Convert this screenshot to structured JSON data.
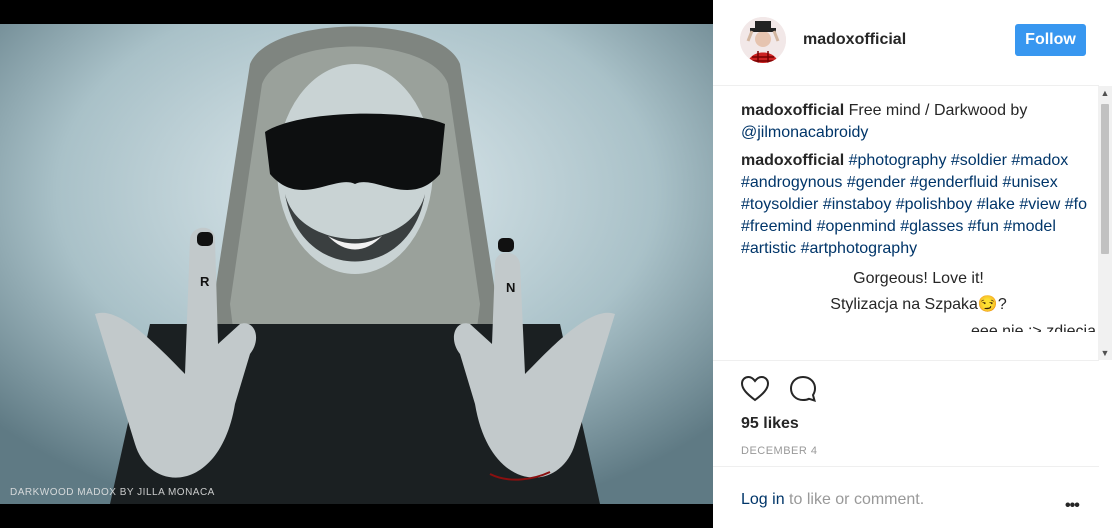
{
  "photo": {
    "watermark": "DARKWOOD MADOX BY JILLA MONACA",
    "finger_letters": [
      "R",
      "N"
    ]
  },
  "header": {
    "username": "madoxofficial",
    "follow_label": "Follow"
  },
  "comments": [
    {
      "user": "madoxofficial",
      "text": " Free mind / Darkwood by ",
      "link": "@jilmonacabroidy"
    },
    {
      "user": "madoxofficial",
      "text": "",
      "link": "#photography #soldier #madox #androgynous #gender #genderfluid #unisex #toysoldier #instaboy #polishboy #lake #view #fo #freemind #openmind #glasses #fun #model #artistic #artphotography"
    }
  ],
  "replies": [
    "Gorgeous! Love it!",
    "Stylizacja na Szpaka😏?",
    "eee nie :> zdjecia"
  ],
  "actions": {
    "likes": "95 likes",
    "date": "DECEMBER 4"
  },
  "footer": {
    "login_link": "Log in",
    "login_rest": " to like or comment.",
    "more": "•••"
  },
  "colors": {
    "follow": "#3897f0",
    "link": "#003569",
    "muted": "#999999"
  }
}
